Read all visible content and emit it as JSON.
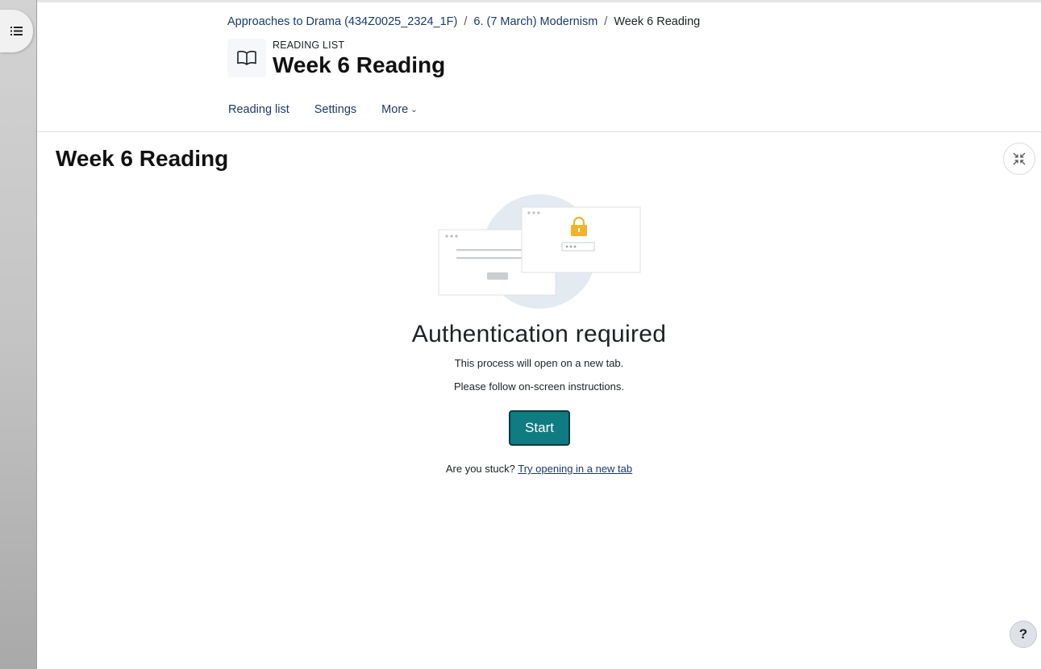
{
  "breadcrumb": {
    "items": [
      {
        "label": "Approaches to Drama (434Z0025_2324_1F)"
      },
      {
        "label": "6. (7 March) Modernism"
      },
      {
        "label": "Week 6 Reading"
      }
    ],
    "separator": "/"
  },
  "page_header": {
    "activity_type": "READING LIST",
    "title": "Week 6 Reading",
    "icon": "book-open-icon"
  },
  "secondary_nav": {
    "reading_list": "Reading list",
    "settings": "Settings",
    "more": "More",
    "more_caret": "⌄"
  },
  "main": {
    "title": "Week 6 Reading",
    "fullscreen_icon": "collapse-arrows-icon"
  },
  "auth": {
    "title": "Authentication required",
    "line1": "This process will open on a new tab.",
    "line2": "Please follow on-screen instructions.",
    "start_label": "Start",
    "stuck_text": "Are you stuck?",
    "stuck_link": "Try opening in a new tab"
  },
  "help": {
    "label": "?"
  },
  "colors": {
    "primary_button": "#0f7b83",
    "link": "#1a3a6b",
    "lock": "#f0b429"
  }
}
